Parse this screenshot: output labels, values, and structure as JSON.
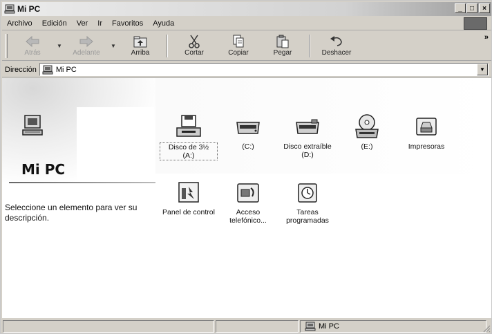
{
  "window": {
    "title": "Mi PC",
    "icon": "computer-icon",
    "controls": {
      "minimize": "_",
      "maximize": "□",
      "close": "×"
    }
  },
  "menubar": {
    "items": [
      {
        "label": "Archivo"
      },
      {
        "label": "Edición"
      },
      {
        "label": "Ver"
      },
      {
        "label": "Ir"
      },
      {
        "label": "Favoritos"
      },
      {
        "label": "Ayuda"
      }
    ]
  },
  "toolbar": {
    "back_label": "Atrás",
    "forward_label": "Adelante",
    "up_label": "Arriba",
    "cut_label": "Cortar",
    "copy_label": "Copiar",
    "paste_label": "Pegar",
    "undo_label": "Deshacer",
    "more": "»"
  },
  "address": {
    "label": "Dirección",
    "value": "Mi PC",
    "dropdown": "▼"
  },
  "panel": {
    "title": "Mi PC",
    "description": "Seleccione un elemento para ver su descripción."
  },
  "icons": [
    {
      "label": "Disco de 3½ (A:)",
      "icon": "floppy-drive-icon"
    },
    {
      "label": "(C:)",
      "icon": "hard-drive-icon"
    },
    {
      "label": "Disco extraíble (D:)",
      "icon": "removable-drive-icon"
    },
    {
      "label": "(E:)",
      "icon": "cd-drive-icon"
    },
    {
      "label": "Impresoras",
      "icon": "printers-folder-icon"
    },
    {
      "label": "Panel de control",
      "icon": "control-panel-icon"
    },
    {
      "label": "Acceso telefónico...",
      "icon": "dialup-networking-icon"
    },
    {
      "label": "Tareas programadas",
      "icon": "scheduled-tasks-icon"
    }
  ],
  "statusbar": {
    "zone": "Mi PC"
  },
  "colors": {
    "chrome": "#d4d0c8",
    "content": "#ffffff",
    "title_gradient_end": "#9a9a9a"
  }
}
